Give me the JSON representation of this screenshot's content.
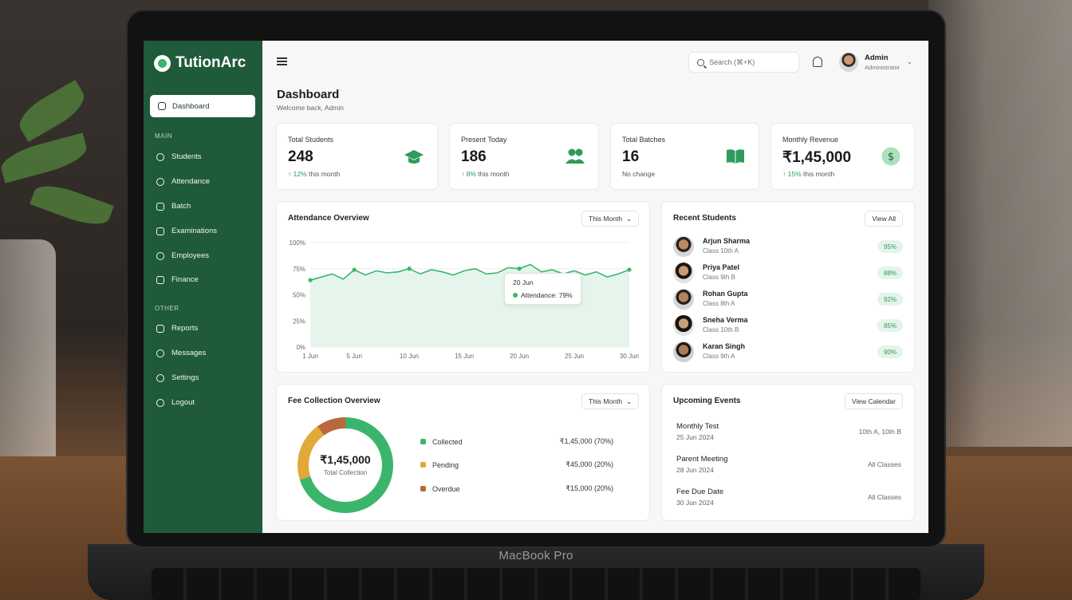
{
  "device": {
    "brand": "MacBook Pro"
  },
  "app": {
    "name": "TutionArc"
  },
  "sidebar": {
    "active": "Dashboard",
    "main_label": "MAIN",
    "main_items": [
      "Students",
      "Attendance",
      "Batch",
      "Examinations",
      "Employees",
      "Finance"
    ],
    "other_label": "OTHER",
    "other_items": [
      "Reports",
      "Messages",
      "Settings",
      "Logout"
    ]
  },
  "header": {
    "search_placeholder": "Search (⌘+K)",
    "user_name": "Admin",
    "user_role": "Administrator"
  },
  "page": {
    "title": "Dashboard",
    "subtitle": "Welcome back, Admin"
  },
  "stats": [
    {
      "label": "Total Students",
      "value": "248",
      "note_up": "↑ 12%",
      "note": " this month",
      "icon": "graduation-cap-icon"
    },
    {
      "label": "Present Today",
      "value": "186",
      "note_up": "↑ 8%",
      "note": " this month",
      "icon": "users-icon"
    },
    {
      "label": "Total Batches",
      "value": "16",
      "note_up": "",
      "note": "No change",
      "icon": "book-icon"
    },
    {
      "label": "Monthly Revenue",
      "value": "₹1,45,000",
      "note_up": "↑ 15%",
      "note": " this month",
      "icon": "rupee-icon"
    }
  ],
  "attendance": {
    "title": "Attendance Overview",
    "filter": "This Month",
    "tooltip_date": "20 Jun",
    "tooltip_value": "Attendance: 79%"
  },
  "chart_data": {
    "type": "area",
    "title": "Attendance Overview",
    "y_ticks": [
      "100%",
      "75%",
      "50%",
      "25%",
      "0%"
    ],
    "x_ticks": [
      "1 Jun",
      "5 Jun",
      "10 Jun",
      "15 Jun",
      "20 Jun",
      "25 Jun",
      "30 Jun"
    ],
    "ylim": [
      0,
      100
    ],
    "xlim": [
      1,
      30
    ],
    "x": [
      1,
      2,
      3,
      4,
      5,
      6,
      7,
      8,
      9,
      10,
      11,
      12,
      13,
      14,
      15,
      16,
      17,
      18,
      19,
      20,
      21,
      22,
      23,
      24,
      25,
      26,
      27,
      28,
      29,
      30
    ],
    "values": [
      64,
      67,
      70,
      65,
      74,
      69,
      73,
      71,
      72,
      75,
      70,
      74,
      72,
      69,
      73,
      75,
      70,
      71,
      76,
      75,
      79,
      72,
      74,
      70,
      73,
      69,
      72,
      67,
      70,
      74
    ],
    "color": "#3bb56b"
  },
  "recent_students": {
    "title": "Recent Students",
    "action": "View All",
    "items": [
      {
        "name": "Arjun Sharma",
        "class": "Class 10th A",
        "pct": "95%"
      },
      {
        "name": "Priya Patel",
        "class": "Class 9th B",
        "pct": "88%"
      },
      {
        "name": "Rohan Gupta",
        "class": "Class 8th A",
        "pct": "92%"
      },
      {
        "name": "Sneha Verma",
        "class": "Class 10th B",
        "pct": "85%"
      },
      {
        "name": "Karan Singh",
        "class": "Class 9th A",
        "pct": "90%"
      }
    ]
  },
  "fees": {
    "title": "Fee Collection Overview",
    "filter": "This Month",
    "total": "₹1,45,000",
    "total_label": "Total Collection",
    "items": [
      {
        "label": "Collected",
        "value": "₹1,45,000 (70%)",
        "color": "#3bb56b",
        "pct": 70
      },
      {
        "label": "Pending",
        "value": "₹45,000 (20%)",
        "color": "#e0a93a",
        "pct": 20
      },
      {
        "label": "Overdue",
        "value": "₹15,000 (20%)",
        "color": "#b9683c",
        "pct": 10
      }
    ]
  },
  "events": {
    "title": "Upcoming Events",
    "action": "View Calendar",
    "items": [
      {
        "title": "Monthly Test",
        "date": "25 Jun 2024",
        "audience": "10th A, 10th B"
      },
      {
        "title": "Parent Meeting",
        "date": "28 Jun 2024",
        "audience": "All Classes"
      },
      {
        "title": "Fee Due Date",
        "date": "30 Jun 2024",
        "audience": "All Classes"
      }
    ]
  }
}
